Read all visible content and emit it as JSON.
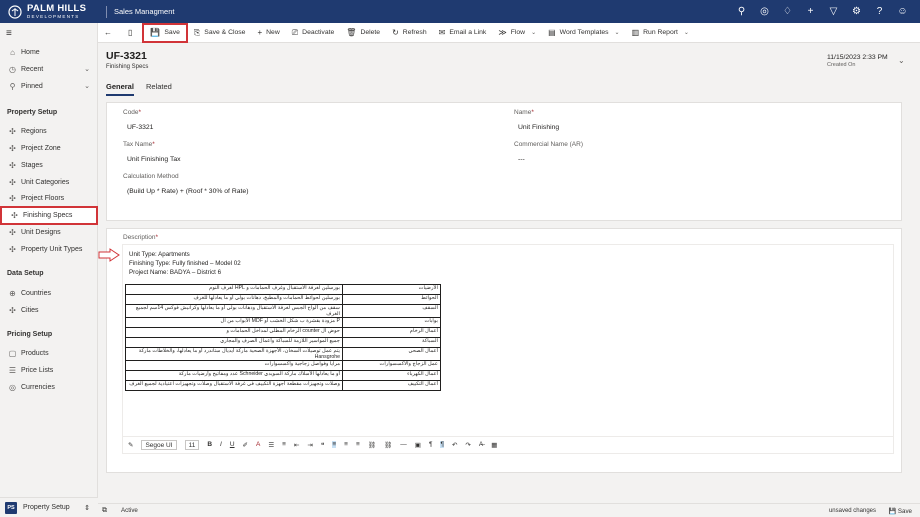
{
  "brand": {
    "line1": "PALM HILLS",
    "line2": "DEVELOPMENTS"
  },
  "app_title": "Sales Managment",
  "top_icons": [
    "search-icon",
    "assistant-icon",
    "lightbulb-icon",
    "plus-icon",
    "filter-icon",
    "settings-icon",
    "help-icon",
    "user-icon"
  ],
  "sidebar": {
    "home": "Home",
    "recent": "Recent",
    "pinned": "Pinned",
    "sections": [
      {
        "heading": "Property Setup",
        "items": [
          "Regions",
          "Project Zone",
          "Stages",
          "Unit Categories",
          "Project Floors",
          "Finishing Specs",
          "Unit Designs",
          "Property Unit Types"
        ]
      },
      {
        "heading": "Data Setup",
        "items": [
          "Countries",
          "Cities"
        ]
      },
      {
        "heading": "Pricing Setup",
        "items": [
          "Products",
          "Price Lists",
          "Currencies"
        ]
      }
    ],
    "area": {
      "badge": "PS",
      "label": "Property Setup"
    }
  },
  "commands": {
    "save": "Save",
    "save_close": "Save & Close",
    "new": "New",
    "deactivate": "Deactivate",
    "delete": "Delete",
    "refresh": "Refresh",
    "email_link": "Email a Link",
    "flow": "Flow",
    "word_templates": "Word Templates",
    "run_report": "Run Report"
  },
  "record": {
    "title": "UF-3321",
    "entity": "Finishing Specs",
    "created_on": "11/15/2023 2:33 PM",
    "created_label": "Created On"
  },
  "tabs": [
    "General",
    "Related"
  ],
  "fields": {
    "code_label": "Code",
    "code": "UF-3321",
    "name_label": "Name",
    "name": "Unit Finishing",
    "tax_label": "Tax Name",
    "tax": "Unit Finishing Tax",
    "commercial_label": "Commercial Name (AR)",
    "commercial": "---",
    "calc_label": "Calculation Method",
    "calc": "(Build Up * Rate) + (Roof * 30% of Rate)",
    "desc_label": "Description"
  },
  "description": {
    "line1": "Unit Type: Apartments",
    "line2": "Finishing Type: Fully finished – Model 02",
    "line3": "Project Name: BADYA – District 6",
    "table": [
      {
        "item": "الأرضيات",
        "spec": "بورسلين لغرفة الاستقبال وغرف الحمامات و HPL لغرف النوم"
      },
      {
        "item": "الحوائط",
        "spec": "بورسلين لحوائط الحمامات والمطبخ، دهانات بولي أو ما يعادلها للغرف"
      },
      {
        "item": "السقف",
        "spec": "سقف من ألواح الجبس لغرفة الاستقبال ودهانات بولي أو ما يعادلها وكرانيش فوكس 14سم لجميع الغرف"
      },
      {
        "item": "بوابات",
        "spec": "P مزودة بقشرة ب شكل الخشب أو MDF الأبواب من ال"
      },
      {
        "item": "أعمال الرخام",
        "spec": "حوض ال counter الرخام المطلي لمداخل الحمامات و"
      },
      {
        "item": "السباكة",
        "spec": "جميع المواسير اللازمة للسباكة وأعمال الصرف والمجاري"
      },
      {
        "item": "أعمال الصحي",
        "spec": "يتم عمل توصيلات السخان، الأجهزة الصحية ماركة أيديال ستاندرد أو ما يعادلها، والخلاطات ماركة Hansgrohe"
      },
      {
        "item": "عمل الزجاج والاكسسوارات",
        "spec": "مرايا وفواصل زجاجية واكسسوارات"
      },
      {
        "item": "أعمال الكهرباء",
        "spec": "أو ما يعادلها الأسلاك ماركة السويدي Schneider عدد ومفاتيح وأرضيات ماركة"
      },
      {
        "item": "أعمال التكييف",
        "spec": "وصلات وتجهيزات مقطعة أجهزة التكييف في غرفة الاستقبال وصلات وتجهيزات اعتيادية لجميع الغرف"
      }
    ]
  },
  "editor": {
    "font": "Segoe UI",
    "size": "11"
  },
  "status": {
    "state": "Active",
    "unsaved": "unsaved changes",
    "save": "Save"
  }
}
